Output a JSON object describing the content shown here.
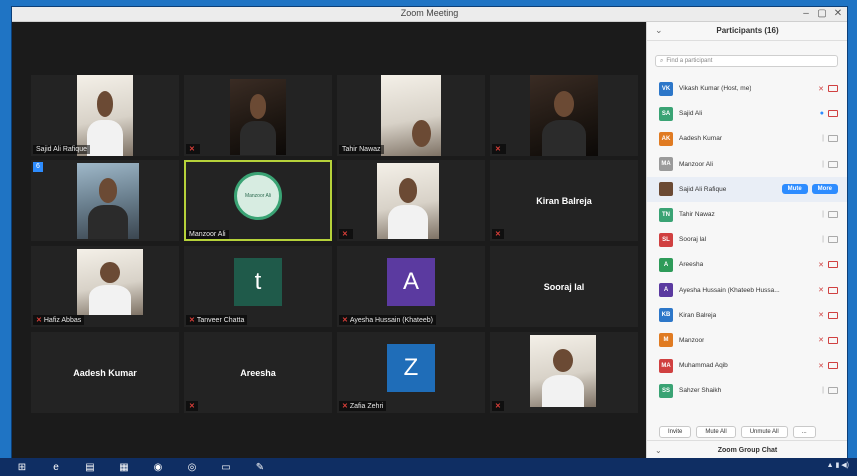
{
  "window": {
    "title": "Zoom Meeting"
  },
  "tiles": [
    {
      "name": "Sajid Ali Rafique"
    },
    {
      "name": ""
    },
    {
      "name": "Tahir Nawaz"
    },
    {
      "name": ""
    },
    {
      "name": "",
      "badge": "6"
    },
    {
      "name": "Manzoor Ali",
      "logo_text": "Manzoor Ali"
    },
    {
      "name": ""
    },
    {
      "big_name": "Kiran Balreja"
    },
    {
      "name": "Hafiz Abbas"
    },
    {
      "name": "Tanveer Chatta",
      "letter": "t",
      "letter_color": "#1f5a4a"
    },
    {
      "name": "Ayesha Hussain (Khateeb)",
      "letter": "A",
      "letter_color": "#5b3aa0"
    },
    {
      "big_name": "Sooraj lal"
    },
    {
      "big_name": "Aadesh Kumar"
    },
    {
      "big_name": "Areesha"
    },
    {
      "name": "Zafia Zehri",
      "letter": "Z",
      "letter_color": "#1f6db8"
    },
    {
      "name": ""
    }
  ],
  "panel": {
    "title": "Participants (16)",
    "search_placeholder": "Find a participant",
    "participants": [
      {
        "initials": "VK",
        "color": "#2d77c9",
        "name": "Vikash Kumar (Host, me)",
        "mic": "muted"
      },
      {
        "initials": "SA",
        "color": "#3aa374",
        "name": "Sajid Ali",
        "mic": "on"
      },
      {
        "initials": "AK",
        "color": "#e07b22",
        "name": "Aadesh Kumar",
        "mic": "off"
      },
      {
        "initials": "MA",
        "color": "#9a9a9a",
        "name": "Manzoor Ali",
        "mic": "off"
      },
      {
        "initials": "",
        "color": "#6b4a34",
        "name": "Sajid Ali Rafique",
        "mic": "none",
        "hover": true,
        "btn_mute": "Mute",
        "btn_more": "More"
      },
      {
        "initials": "TN",
        "color": "#3aa374",
        "name": "Tahir Nawaz",
        "mic": "off"
      },
      {
        "initials": "SL",
        "color": "#d04040",
        "name": "Sooraj lal",
        "mic": "off"
      },
      {
        "initials": "A",
        "color": "#2e9b59",
        "name": "Areesha",
        "mic": "muted"
      },
      {
        "initials": "A",
        "color": "#5b3aa0",
        "name": "Ayesha Hussain (Khateeb Hussa...",
        "mic": "muted"
      },
      {
        "initials": "KB",
        "color": "#2d77c9",
        "name": "Kiran Balreja",
        "mic": "muted"
      },
      {
        "initials": "M",
        "color": "#e07b22",
        "name": "Manzoor",
        "mic": "muted"
      },
      {
        "initials": "MA",
        "color": "#d04040",
        "name": "Muhammad Aqib",
        "mic": "muted"
      },
      {
        "initials": "SS",
        "color": "#3aa374",
        "name": "Sahzer Shaikh",
        "mic": "off"
      }
    ],
    "footer_buttons": [
      "Invite",
      "Mute All",
      "Unmute All",
      "..."
    ],
    "chat_title": "Zoom Group Chat"
  },
  "taskbar": {
    "icons": [
      "windows-start-icon",
      "ie-icon",
      "explorer-icon",
      "excel-icon",
      "firefox-icon",
      "chrome-icon",
      "zoom-icon",
      "paint-icon"
    ]
  }
}
